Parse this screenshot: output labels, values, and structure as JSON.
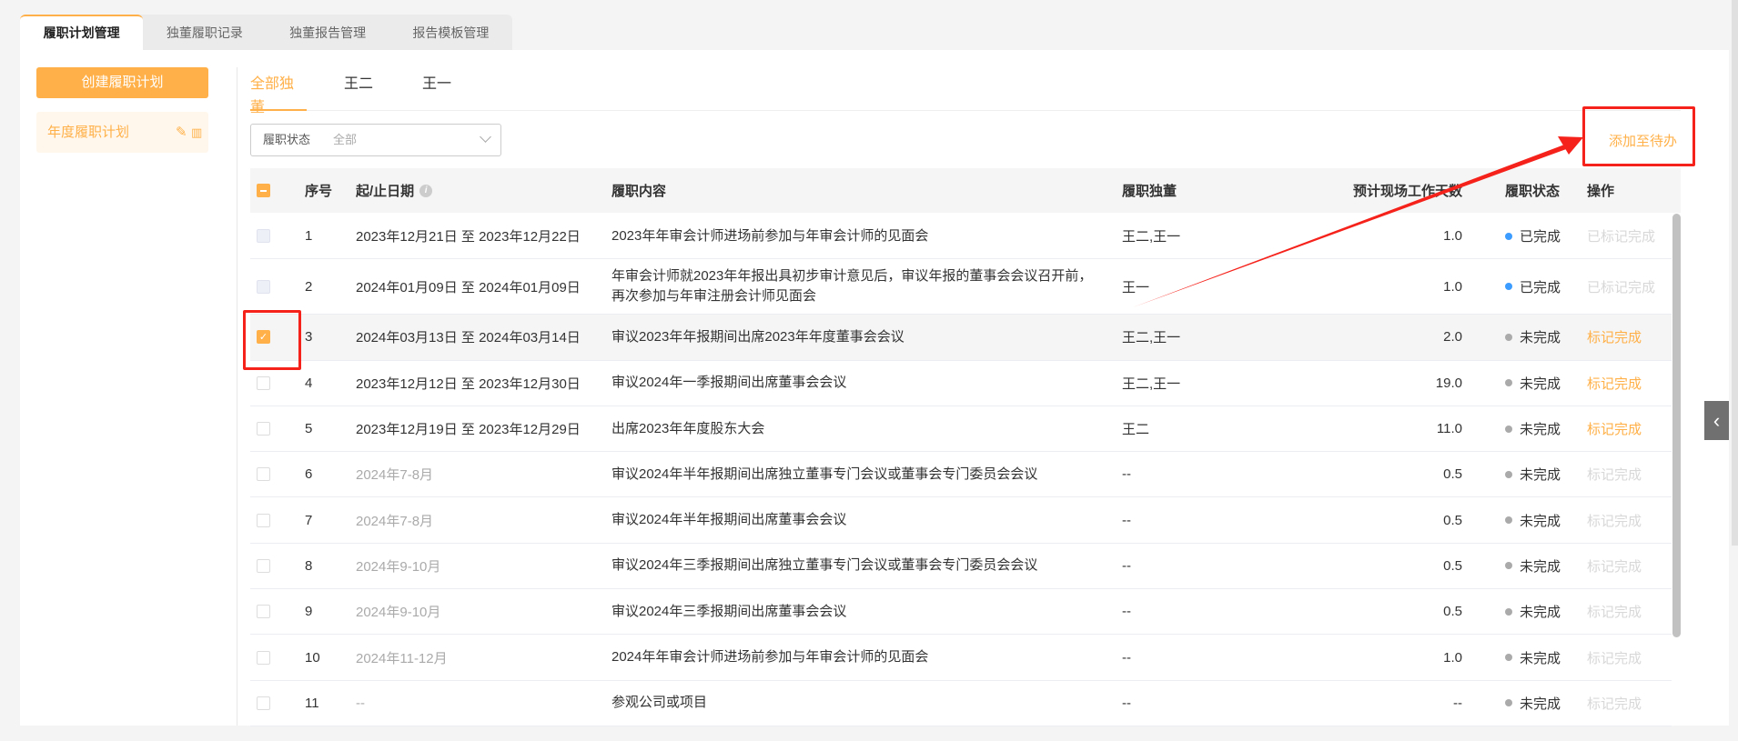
{
  "top_tabs": [
    "履职计划管理",
    "独董履职记录",
    "独董报告管理",
    "报告模板管理"
  ],
  "sidebar": {
    "create_label": "创建履职计划",
    "plan_item": "年度履职计划",
    "edit_icon": "✎",
    "delete_icon": "🗑"
  },
  "sub_tabs": [
    "全部独董",
    "王二",
    "王一"
  ],
  "filter": {
    "label": "履职状态",
    "value": "全部"
  },
  "add_todo_label": "添加至待办",
  "columns": [
    "序号",
    "起/止日期",
    "履职内容",
    "履职独董",
    "预计现场工作天数",
    "履职状态",
    "操作"
  ],
  "colors": {
    "accent": "#ffb048",
    "done": "#3c9cff",
    "todo": "#aaaaaa",
    "annotation": "#f5221b"
  },
  "rows": [
    {
      "no": "1",
      "date": "2023年12月21日 至 2023年12月22日",
      "content": "2023年年审会计师进场前参加与年审会计师的见面会",
      "directors": "王二,王一",
      "days": "1.0",
      "status": "已完成",
      "action": "已标记完成",
      "checked": false,
      "disabled": true
    },
    {
      "no": "2",
      "date": "2024年01月09日 至 2024年01月09日",
      "content": "年审会计师就2023年年报出具初步审计意见后，审议年报的董事会会议召开前，再次参加与年审注册会计师见面会",
      "directors": "王一",
      "days": "1.0",
      "status": "已完成",
      "action": "已标记完成",
      "checked": false,
      "disabled": true
    },
    {
      "no": "3",
      "date": "2024年03月13日 至 2024年03月14日",
      "content": "审议2023年年报期间出席2023年年度董事会会议",
      "directors": "王二,王一",
      "days": "2.0",
      "status": "未完成",
      "action": "标记完成",
      "checked": true,
      "disabled": false
    },
    {
      "no": "4",
      "date": "2023年12月12日 至 2023年12月30日",
      "content": "审议2024年一季报期间出席董事会会议",
      "directors": "王二,王一",
      "days": "19.0",
      "status": "未完成",
      "action": "标记完成",
      "checked": false,
      "disabled": false
    },
    {
      "no": "5",
      "date": "2023年12月19日 至 2023年12月29日",
      "content": "出席2023年年度股东大会",
      "directors": "王二",
      "days": "11.0",
      "status": "未完成",
      "action": "标记完成",
      "checked": false,
      "disabled": false
    },
    {
      "no": "6",
      "date": "2024年7-8月",
      "content": "审议2024年半年报期间出席独立董事专门会议或董事会专门委员会会议",
      "directors": "--",
      "days": "0.5",
      "status": "未完成",
      "action": "标记完成",
      "checked": false,
      "disabled": false,
      "muted": true
    },
    {
      "no": "7",
      "date": "2024年7-8月",
      "content": "审议2024年半年报期间出席董事会会议",
      "directors": "--",
      "days": "0.5",
      "status": "未完成",
      "action": "标记完成",
      "checked": false,
      "disabled": false,
      "muted": true
    },
    {
      "no": "8",
      "date": "2024年9-10月",
      "content": "审议2024年三季报期间出席独立董事专门会议或董事会专门委员会会议",
      "directors": "--",
      "days": "0.5",
      "status": "未完成",
      "action": "标记完成",
      "checked": false,
      "disabled": false,
      "muted": true
    },
    {
      "no": "9",
      "date": "2024年9-10月",
      "content": "审议2024年三季报期间出席董事会会议",
      "directors": "--",
      "days": "0.5",
      "status": "未完成",
      "action": "标记完成",
      "checked": false,
      "disabled": false,
      "muted": true
    },
    {
      "no": "10",
      "date": "2024年11-12月",
      "content": "2024年年审会计师进场前参加与年审会计师的见面会",
      "directors": "--",
      "days": "1.0",
      "status": "未完成",
      "action": "标记完成",
      "checked": false,
      "disabled": false,
      "muted": true
    },
    {
      "no": "11",
      "date": "--",
      "content": "参观公司或项目",
      "directors": "--",
      "days": "--",
      "status": "未完成",
      "action": "标记完成",
      "checked": false,
      "disabled": false,
      "muted": true
    }
  ]
}
